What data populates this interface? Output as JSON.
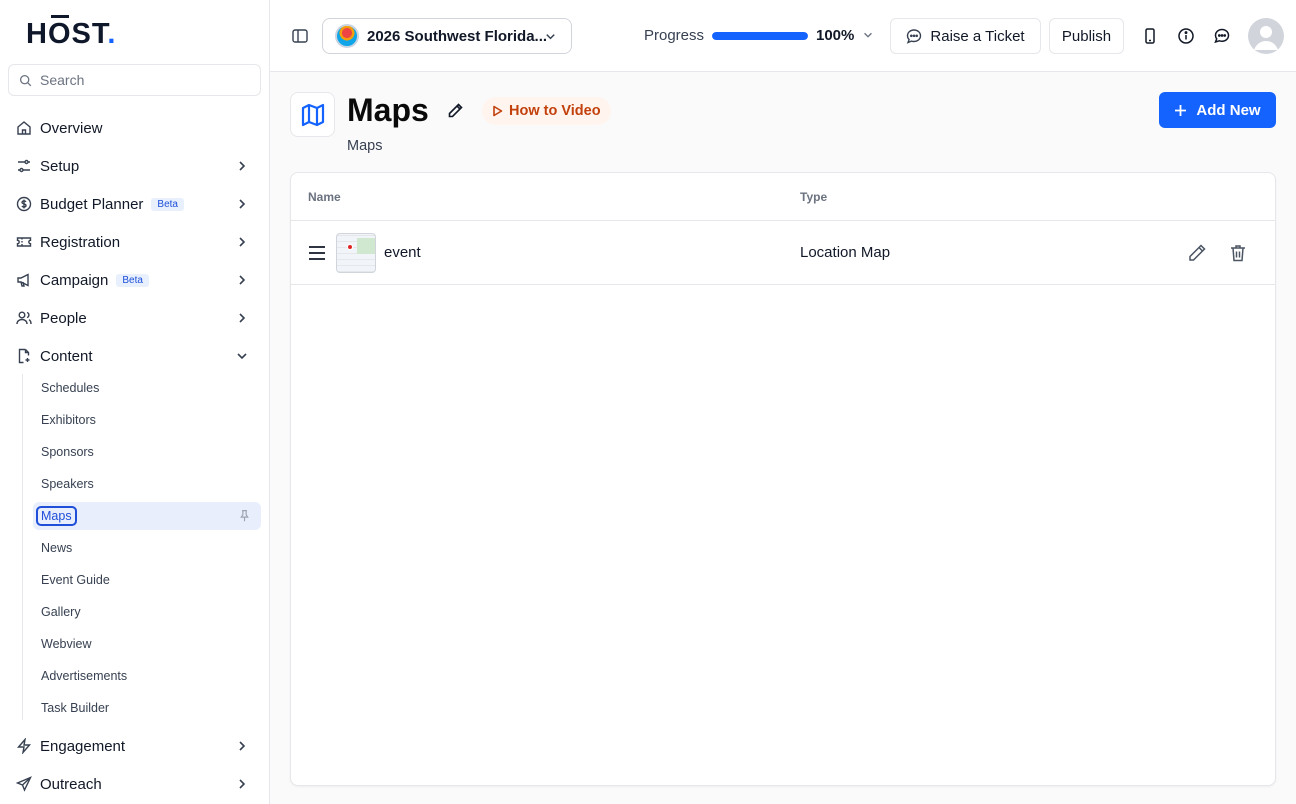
{
  "brand": {
    "logo_text_h": "H",
    "logo_text_o": "O",
    "logo_text_st": "ST",
    "logo_dot": ".",
    "accent": "#1463ff"
  },
  "search": {
    "placeholder": "Search"
  },
  "sidebar": {
    "items": [
      {
        "label": "Overview",
        "icon": "home-icon"
      },
      {
        "label": "Setup",
        "icon": "sliders-icon"
      },
      {
        "label": "Budget Planner",
        "icon": "dollar-icon",
        "badge": "Beta"
      },
      {
        "label": "Registration",
        "icon": "ticket-icon"
      },
      {
        "label": "Campaign",
        "icon": "megaphone-icon",
        "badge": "Beta"
      },
      {
        "label": "People",
        "icon": "users-icon"
      },
      {
        "label": "Content",
        "icon": "file-icon",
        "expanded": true
      },
      {
        "label": "Engagement",
        "icon": "bolt-icon"
      },
      {
        "label": "Outreach",
        "icon": "send-icon"
      }
    ],
    "content_sub": [
      "Schedules",
      "Exhibitors",
      "Sponsors",
      "Speakers",
      "Maps",
      "News",
      "Event Guide",
      "Gallery",
      "Webview",
      "Advertisements",
      "Task Builder"
    ],
    "active_sub": "Maps"
  },
  "topbar": {
    "event_name": "2026 Southwest Florida...",
    "progress_label": "Progress",
    "progress_value": "100%",
    "progress_fraction": 1.0,
    "raise_ticket": "Raise a Ticket",
    "publish": "Publish"
  },
  "page": {
    "title": "Maps",
    "subtitle": "Maps",
    "how_to": "How to Video",
    "add_new": "Add New"
  },
  "table": {
    "headers": {
      "name": "Name",
      "type": "Type"
    },
    "rows": [
      {
        "name": "event",
        "type": "Location Map"
      }
    ]
  }
}
